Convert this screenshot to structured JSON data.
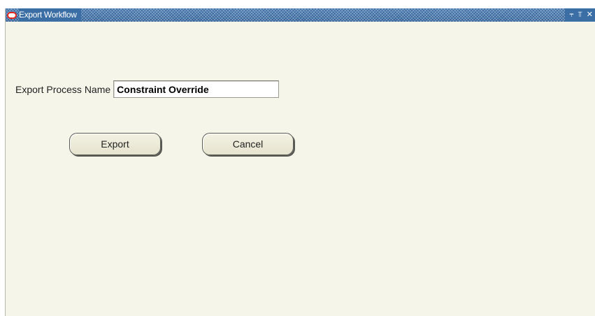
{
  "window": {
    "title": "Export Workflow"
  },
  "form": {
    "process_name_label": "Export Process Name",
    "process_name_value": "Constraint Override"
  },
  "buttons": {
    "export_label": "Export",
    "cancel_label": "Cancel"
  },
  "colors": {
    "titlebar": "#3a6ea5",
    "window_background": "#f6f5ea",
    "logo_red": "#e1261c"
  },
  "icons": {
    "logo": "oracle-logo-icon",
    "minimize": "minimize-icon",
    "maximize": "maximize-icon",
    "close": "close-icon"
  }
}
